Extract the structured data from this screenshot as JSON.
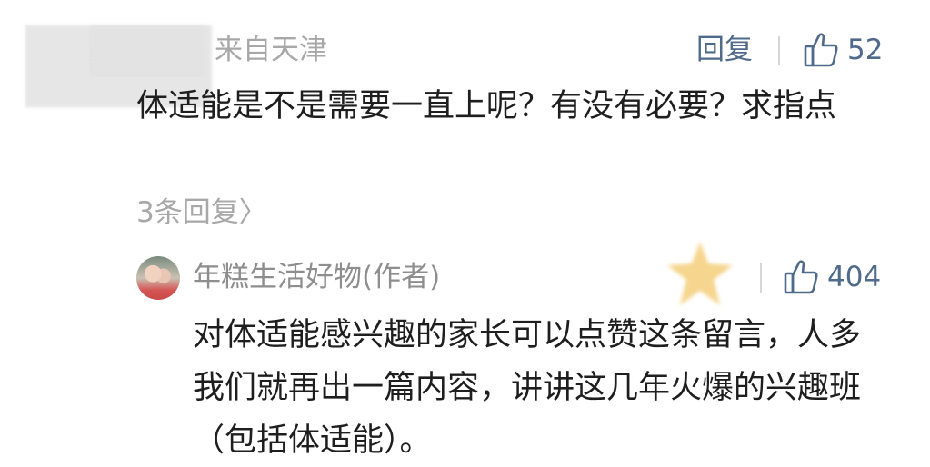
{
  "comment": {
    "location": "来自天津",
    "reply_label": "回复",
    "like_count": "52",
    "text": "体适能是不是需要一直上呢？有没有必要？求指点",
    "reply_count_label": "3条回复〉"
  },
  "author_reply": {
    "name": "年糕生活好物(作者)",
    "like_count": "404",
    "text": "对体适能感兴趣的家长可以点赞这条留言，人多我们就再出一篇内容，讲讲这几年火爆的兴趣班（包括体适能）。"
  },
  "colors": {
    "link": "#4f6a8a",
    "muted": "#a8a8a8",
    "text": "#1e1e1e"
  },
  "icons": {
    "like": "thumbs-up-icon"
  }
}
